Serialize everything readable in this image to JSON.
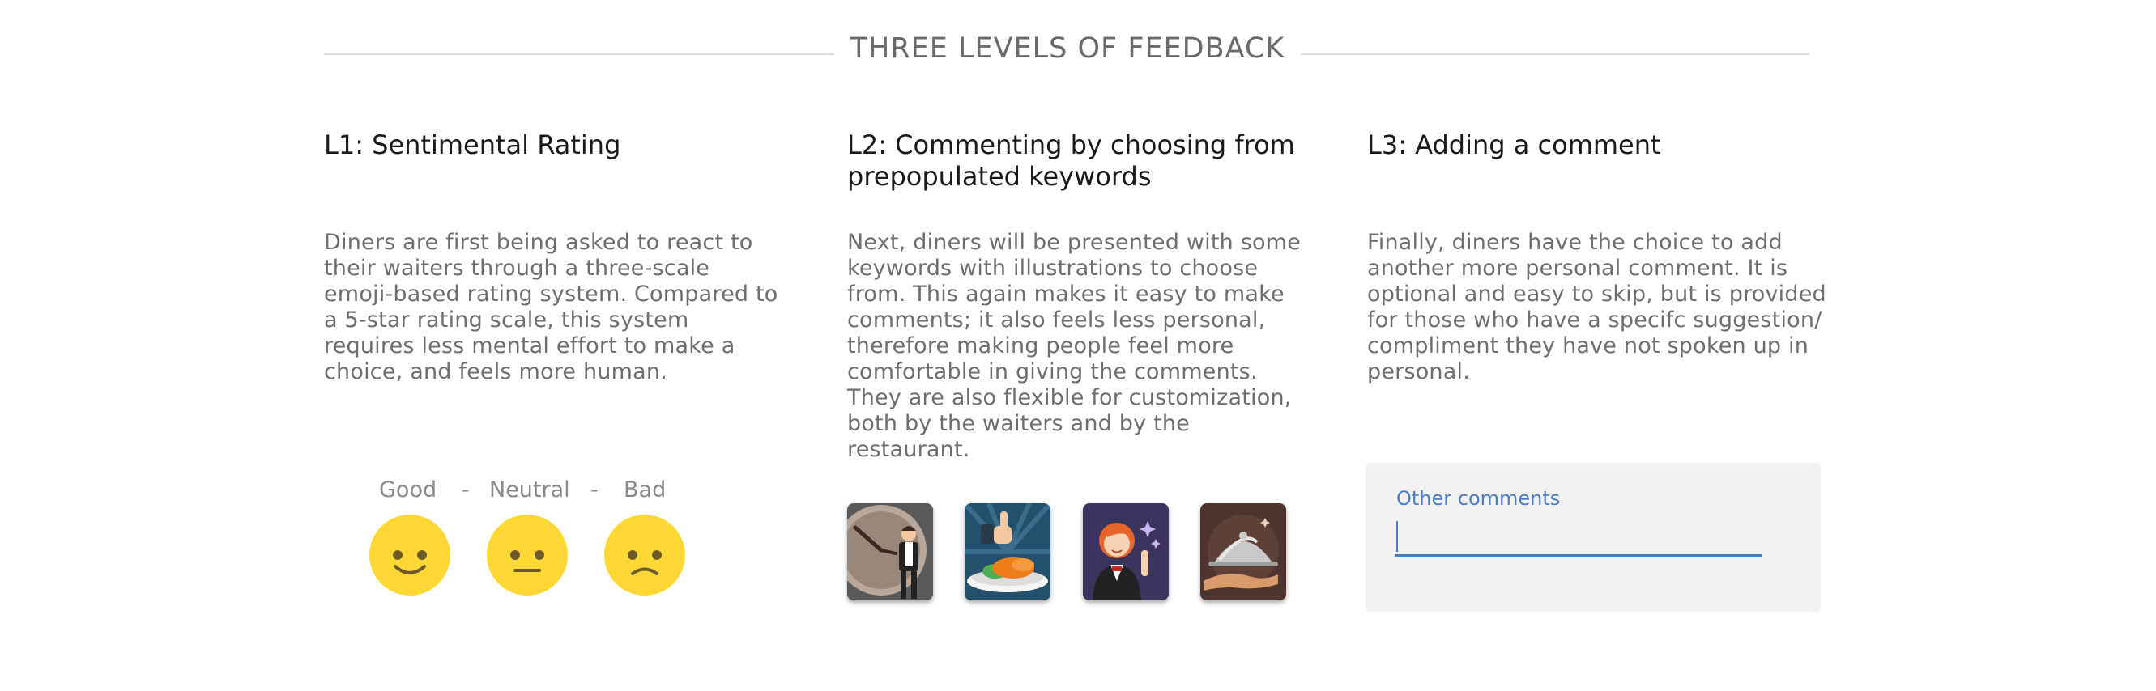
{
  "header": {
    "title": "THREE LEVELS OF FEEDBACK"
  },
  "columns": [
    {
      "title": "L1: Sentimental Rating",
      "body": "Diners are first being asked to react to their waiters through a three-scale emoji-based rating system. Compared to a 5-star rating scale, this system requires less mental effort to make a choice, and feels more human."
    },
    {
      "title": "L2: Commenting by choosing from prepopulated keywords",
      "body": "Next, diners will be presented with some keywords with illustrations to choose from. This again makes it easy to make comments; it also feels less personal, therefore making people feel more comfortable in giving the comments. They are also flexible for customization, both by the waiters and by the restaurant."
    },
    {
      "title": "L3: Adding a comment",
      "body": "Finally, diners have the choice to add another more personal comment. It is optional and easy to skip, but is provided for those who have a specifc suggestion/ compliment they have not spoken up in personal."
    }
  ],
  "rating": {
    "labels": [
      "Good",
      "-",
      "Neutral",
      "-",
      "Bad"
    ],
    "emoji_color": "#fdd835",
    "icons": [
      "smile-emoji-icon",
      "neutral-emoji-icon",
      "sad-emoji-icon"
    ]
  },
  "keywords": {
    "icons": [
      "clock-waiter-icon",
      "thumbs-up-food-icon",
      "friendly-waitress-icon",
      "serving-cloche-icon"
    ]
  },
  "comment": {
    "label": "Other comments",
    "value": "",
    "accent_color": "#4a7cc9"
  }
}
